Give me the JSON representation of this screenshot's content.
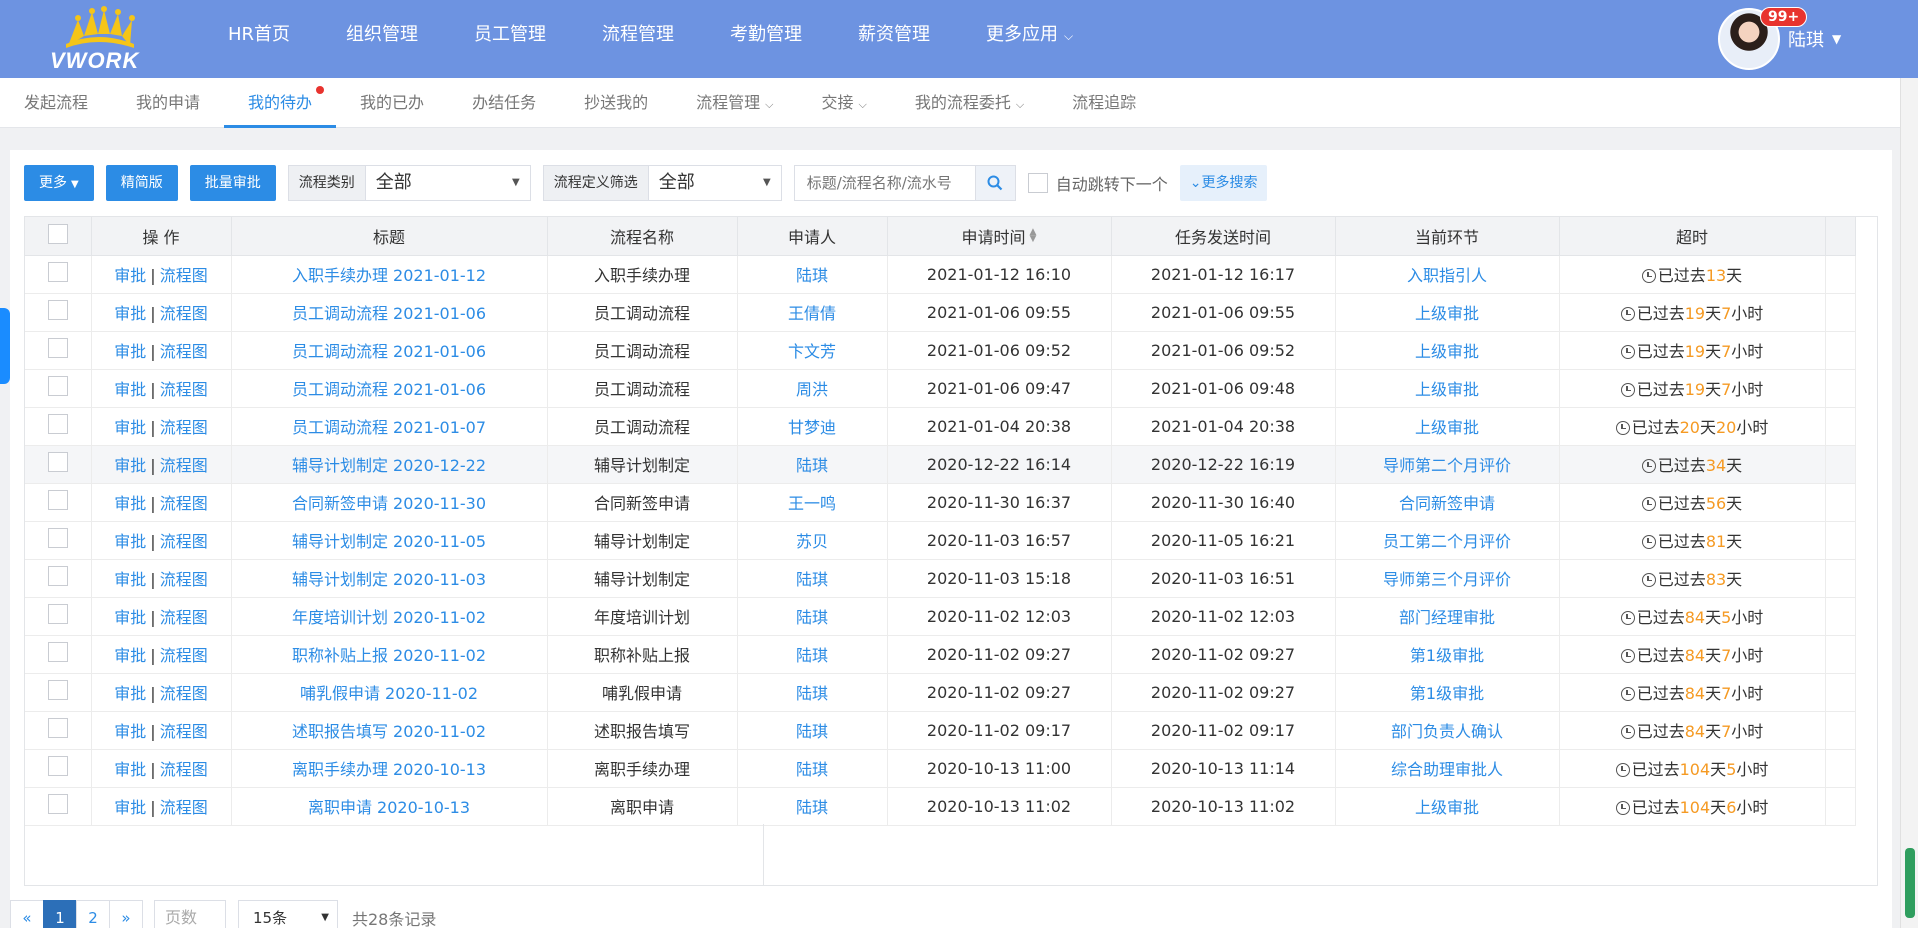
{
  "header": {
    "logo_text": "VWORK",
    "nav": [
      "HR首页",
      "组织管理",
      "员工管理",
      "流程管理",
      "考勤管理",
      "薪资管理",
      "更多应用"
    ],
    "user_name": "陆琪",
    "badge": "99+"
  },
  "subnav": {
    "items": [
      "发起流程",
      "我的申请",
      "我的待办",
      "我的已办",
      "办结任务",
      "抄送我的",
      "流程管理",
      "交接",
      "我的流程委托",
      "流程追踪"
    ],
    "active": "我的待办"
  },
  "toolbar": {
    "more": "更多",
    "simple": "精简版",
    "batch": "批量审批",
    "type_label": "流程类别",
    "type_value": "全部",
    "def_label": "流程定义筛选",
    "def_value": "全部",
    "search_placeholder": "标题/流程名称/流水号",
    "auto_next": "自动跳转下一个",
    "more_search": "更多搜索"
  },
  "table": {
    "headers": [
      "",
      "操 作",
      "标题",
      "流程名称",
      "申请人",
      "申请时间",
      "任务发送时间",
      "当前环节",
      "超时"
    ],
    "action_approve": "审批",
    "action_sep": "|",
    "action_chart": "流程图",
    "overdue_prefix": "已过去",
    "day_unit": "天",
    "hour_unit": "小时",
    "rows": [
      {
        "title": "入职手续办理 2021-01-12",
        "process": "入职手续办理",
        "applicant": "陆琪",
        "apply_time": "2021-01-12 16:10",
        "send_time": "2021-01-12 16:17",
        "node": "入职指引人",
        "days": "13",
        "hours": ""
      },
      {
        "title": "员工调动流程 2021-01-06",
        "process": "员工调动流程",
        "applicant": "王倩倩",
        "apply_time": "2021-01-06 09:55",
        "send_time": "2021-01-06 09:55",
        "node": "上级审批",
        "days": "19",
        "hours": "7"
      },
      {
        "title": "员工调动流程 2021-01-06",
        "process": "员工调动流程",
        "applicant": "卞文芳",
        "apply_time": "2021-01-06 09:52",
        "send_time": "2021-01-06 09:52",
        "node": "上级审批",
        "days": "19",
        "hours": "7"
      },
      {
        "title": "员工调动流程 2021-01-06",
        "process": "员工调动流程",
        "applicant": "周洪",
        "apply_time": "2021-01-06 09:47",
        "send_time": "2021-01-06 09:48",
        "node": "上级审批",
        "days": "19",
        "hours": "7"
      },
      {
        "title": "员工调动流程 2021-01-07",
        "process": "员工调动流程",
        "applicant": "甘梦迪",
        "apply_time": "2021-01-04 20:38",
        "send_time": "2021-01-04 20:38",
        "node": "上级审批",
        "days": "20",
        "hours": "20"
      },
      {
        "title": "辅导计划制定 2020-12-22",
        "process": "辅导计划制定",
        "applicant": "陆琪",
        "apply_time": "2020-12-22 16:14",
        "send_time": "2020-12-22 16:19",
        "node": "导师第二个月评价",
        "days": "34",
        "hours": ""
      },
      {
        "title": "合同新签申请 2020-11-30",
        "process": "合同新签申请",
        "applicant": "王一鸣",
        "apply_time": "2020-11-30 16:37",
        "send_time": "2020-11-30 16:40",
        "node": "合同新签申请",
        "days": "56",
        "hours": ""
      },
      {
        "title": "辅导计划制定 2020-11-05",
        "process": "辅导计划制定",
        "applicant": "苏贝",
        "apply_time": "2020-11-03 16:57",
        "send_time": "2020-11-05 16:21",
        "node": "员工第二个月评价",
        "days": "81",
        "hours": ""
      },
      {
        "title": "辅导计划制定 2020-11-03",
        "process": "辅导计划制定",
        "applicant": "陆琪",
        "apply_time": "2020-11-03 15:18",
        "send_time": "2020-11-03 16:51",
        "node": "导师第三个月评价",
        "days": "83",
        "hours": ""
      },
      {
        "title": "年度培训计划 2020-11-02",
        "process": "年度培训计划",
        "applicant": "陆琪",
        "apply_time": "2020-11-02 12:03",
        "send_time": "2020-11-02 12:03",
        "node": "部门经理审批",
        "days": "84",
        "hours": "5"
      },
      {
        "title": "职称补贴上报 2020-11-02",
        "process": "职称补贴上报",
        "applicant": "陆琪",
        "apply_time": "2020-11-02 09:27",
        "send_time": "2020-11-02 09:27",
        "node": "第1级审批",
        "days": "84",
        "hours": "7"
      },
      {
        "title": "哺乳假申请 2020-11-02",
        "process": "哺乳假申请",
        "applicant": "陆琪",
        "apply_time": "2020-11-02 09:27",
        "send_time": "2020-11-02 09:27",
        "node": "第1级审批",
        "days": "84",
        "hours": "7"
      },
      {
        "title": "述职报告填写 2020-11-02",
        "process": "述职报告填写",
        "applicant": "陆琪",
        "apply_time": "2020-11-02 09:17",
        "send_time": "2020-11-02 09:17",
        "node": "部门负责人确认",
        "days": "84",
        "hours": "7"
      },
      {
        "title": "离职手续办理 2020-10-13",
        "process": "离职手续办理",
        "applicant": "陆琪",
        "apply_time": "2020-10-13 11:00",
        "send_time": "2020-10-13 11:14",
        "node": "综合助理审批人",
        "days": "104",
        "hours": "5"
      },
      {
        "title": "离职申请 2020-10-13",
        "process": "离职申请",
        "applicant": "陆琪",
        "apply_time": "2020-10-13 11:02",
        "send_time": "2020-10-13 11:02",
        "node": "上级审批",
        "days": "104",
        "hours": "6"
      }
    ],
    "highlight_row": 5
  },
  "pager": {
    "prev": "«",
    "pages": [
      "1",
      "2"
    ],
    "current": "1",
    "next": "»",
    "page_input_placeholder": "页数",
    "page_size": "15条",
    "total": "共28条记录"
  },
  "colors": {
    "nav_bg": "#6d93e1",
    "accent": "#2c8ce5",
    "overdue": "#f59a23",
    "badge": "#e8332e"
  }
}
